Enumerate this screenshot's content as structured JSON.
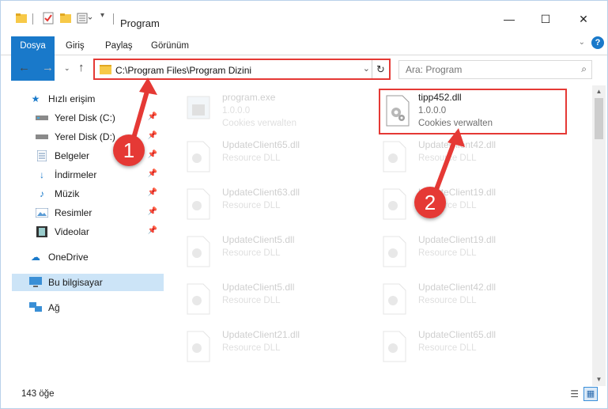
{
  "window": {
    "title": "Program",
    "controls": [
      "—",
      "☐",
      "✕"
    ]
  },
  "ribbon": {
    "tabs": [
      "Dosya",
      "Giriş",
      "Paylaş",
      "Görünüm"
    ],
    "help": "?"
  },
  "nav": {
    "address": "C:\\Program Files\\Program Dizini",
    "search_placeholder": "Ara: Program"
  },
  "sidebar": {
    "items": [
      {
        "label": "Hızlı erişim",
        "icon": "star-icon"
      },
      {
        "label": "Yerel Disk (C:)",
        "icon": "drive-icon",
        "pinned": true
      },
      {
        "label": "Yerel Disk (D:)",
        "icon": "drive-icon",
        "pinned": true
      },
      {
        "label": "Belgeler",
        "icon": "documents-icon",
        "pinned": true
      },
      {
        "label": "İndirmeler",
        "icon": "download-icon",
        "pinned": true
      },
      {
        "label": "Müzik",
        "icon": "music-icon",
        "pinned": true
      },
      {
        "label": "Resimler",
        "icon": "pictures-icon",
        "pinned": true
      },
      {
        "label": "Videolar",
        "icon": "video-icon",
        "pinned": true
      },
      {
        "label": "OneDrive",
        "icon": "cloud-icon"
      },
      {
        "label": "Bu bilgisayar",
        "icon": "computer-icon",
        "selected": true
      },
      {
        "label": "Ağ",
        "icon": "network-icon"
      }
    ]
  },
  "files": [
    {
      "name": "program.exe",
      "line2": "1.0.0.0",
      "line3": "Cookies verwalten",
      "faded": true
    },
    {
      "name": "tipp452.dll",
      "line2": "1.0.0.0",
      "line3": "Cookies verwalten",
      "highlight": true
    },
    {
      "name": "UpdateClient65.dll",
      "line2": "Resource DLL",
      "faded": true
    },
    {
      "name": "UpdateClient42.dll",
      "line2": "Resource DLL",
      "faded": true
    },
    {
      "name": "UpdateClient63.dll",
      "line2": "Resource DLL",
      "faded": true
    },
    {
      "name": "UpdateClient19.dll",
      "line2": "Resource DLL",
      "faded": true
    },
    {
      "name": "UpdateClient5.dll",
      "line2": "Resource DLL",
      "faded": true
    },
    {
      "name": "UpdateClient19.dll",
      "line2": "Resource DLL",
      "faded": true
    },
    {
      "name": "UpdateClient5.dll",
      "line2": "Resource DLL",
      "faded": true
    },
    {
      "name": "UpdateClient42.dll",
      "line2": "Resource DLL",
      "faded": true
    },
    {
      "name": "UpdateClient21.dll",
      "line2": "Resource DLL",
      "faded": true
    },
    {
      "name": "UpdateClient65.dll",
      "line2": "Resource DLL",
      "faded": true
    }
  ],
  "status": {
    "count": "143 öğe"
  },
  "annotations": {
    "step1": "1",
    "step2": "2",
    "color": "#e53935"
  }
}
